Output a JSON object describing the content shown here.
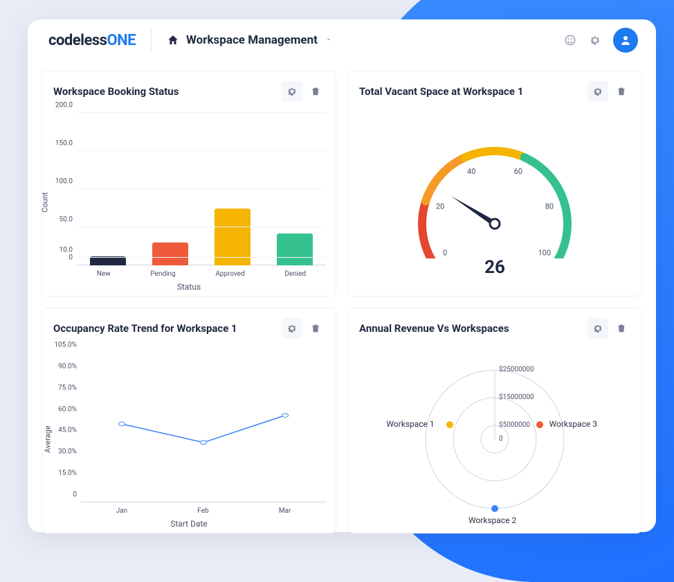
{
  "brand": {
    "left": "codeless",
    "right": "ONE"
  },
  "header": {
    "title": "Workspace Management"
  },
  "widgets": {
    "booking": {
      "title": "Workspace Booking Status",
      "xlabel": "Status",
      "ylabel": "Count"
    },
    "vacant": {
      "title": "Total Vacant Space at Workspace 1",
      "value": "26"
    },
    "occupancy": {
      "title": "Occupancy Rate Trend for Workspace 1",
      "xlabel": "Start Date",
      "ylabel": "Average"
    },
    "revenue": {
      "title": "Annual Revenue Vs Workspaces"
    }
  },
  "chart_data": [
    {
      "id": "booking",
      "type": "bar",
      "categories": [
        "New",
        "Pending",
        "Approved",
        "Denied"
      ],
      "values": [
        12,
        30,
        75,
        42
      ],
      "colors": [
        "#1f2940",
        "#ef5a3a",
        "#f4b400",
        "#35c18e"
      ],
      "xlabel": "Status",
      "ylabel": "Count",
      "yticks": [
        0,
        10.0,
        50.0,
        100.0,
        150.0,
        200.0
      ],
      "ylim": [
        0,
        200
      ]
    },
    {
      "id": "vacant",
      "type": "gauge",
      "value": 26,
      "min": 0,
      "max": 100,
      "ticks": [
        0,
        20,
        40,
        60,
        80,
        100
      ],
      "segments": [
        {
          "from": 0,
          "to": 20,
          "color": "#e4472f"
        },
        {
          "from": 20,
          "to": 40,
          "color": "#f59a26"
        },
        {
          "from": 40,
          "to": 60,
          "color": "#f4b400"
        },
        {
          "from": 60,
          "to": 100,
          "color": "#35c18e"
        }
      ]
    },
    {
      "id": "occupancy",
      "type": "line",
      "x": [
        "Jan",
        "Feb",
        "Mar"
      ],
      "series": [
        {
          "name": "Average",
          "values": [
            55,
            42,
            61
          ],
          "color": "#3b82f6"
        }
      ],
      "xlabel": "Start Date",
      "ylabel": "Average",
      "yticks": [
        "0",
        "15.0%",
        "30.0%",
        "45.0%",
        "60.0%",
        "75.0%",
        "90.0%",
        "105.0%"
      ],
      "ylim": [
        0,
        105
      ]
    },
    {
      "id": "revenue",
      "type": "polar",
      "rticks": [
        "0",
        "$5000000",
        "$15000000",
        "$25000000"
      ],
      "series": [
        {
          "name": "Workspace 1",
          "angle_deg": 288,
          "r": 17000000,
          "color": "#f4b400"
        },
        {
          "name": "Workspace 2",
          "angle_deg": 180,
          "r": 25000000,
          "color": "#3b82f6"
        },
        {
          "name": "Workspace 3",
          "angle_deg": 72,
          "r": 17000000,
          "color": "#ef5a3a"
        }
      ],
      "rlim": [
        0,
        25000000
      ]
    }
  ]
}
